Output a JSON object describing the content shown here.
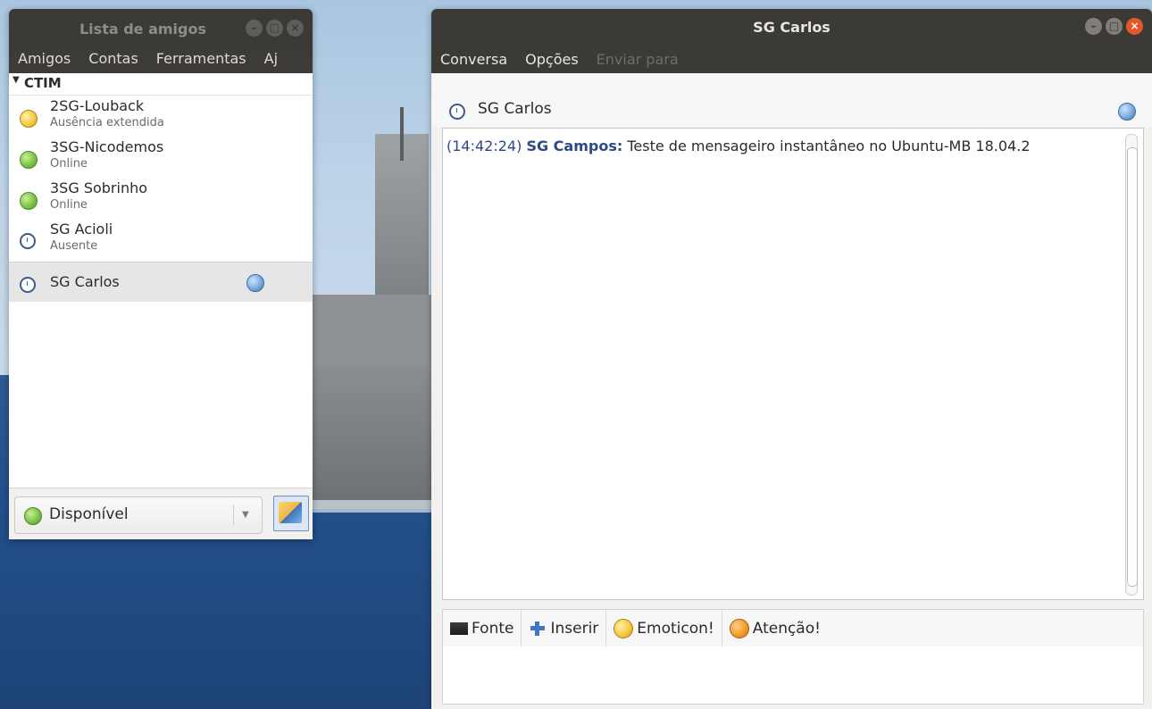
{
  "buddy_list": {
    "title": "Lista de amigos",
    "menu": [
      "Amigos",
      "Contas",
      "Ferramentas",
      "Aj"
    ],
    "group": "CTIM",
    "buddies": [
      {
        "name": "2SG-Louback",
        "status": "Ausência extendida",
        "icon": "extended-away-icon"
      },
      {
        "name": "3SG-Nicodemos",
        "status": "Online",
        "icon": "online-icon"
      },
      {
        "name": "3SG Sobrinho",
        "status": "Online",
        "icon": "online-icon"
      },
      {
        "name": "SG Acioli",
        "status": "Ausente",
        "icon": "away-clock-icon"
      },
      {
        "name": "SG Carlos",
        "status": "",
        "icon": "away-clock-icon"
      }
    ],
    "status_selector": "Disponível"
  },
  "chat": {
    "title": "SG Carlos",
    "menu": [
      "Conversa",
      "Opções",
      "Enviar para"
    ],
    "contact": "SG Carlos",
    "messages": [
      {
        "time": "(14:42:24)",
        "sender": "SG Campos:",
        "text": "Teste de mensageiro instantâneo no Ubuntu-MB 18.04.2"
      }
    ],
    "toolbar": {
      "font": "Fonte",
      "insert": "Inserir",
      "emoticon": "Emoticon!",
      "attention": "Atenção!"
    }
  },
  "colors": {
    "titlebar": "#3b3a36",
    "close_button": "#e5562a",
    "link_blue": "#2d4a84"
  }
}
